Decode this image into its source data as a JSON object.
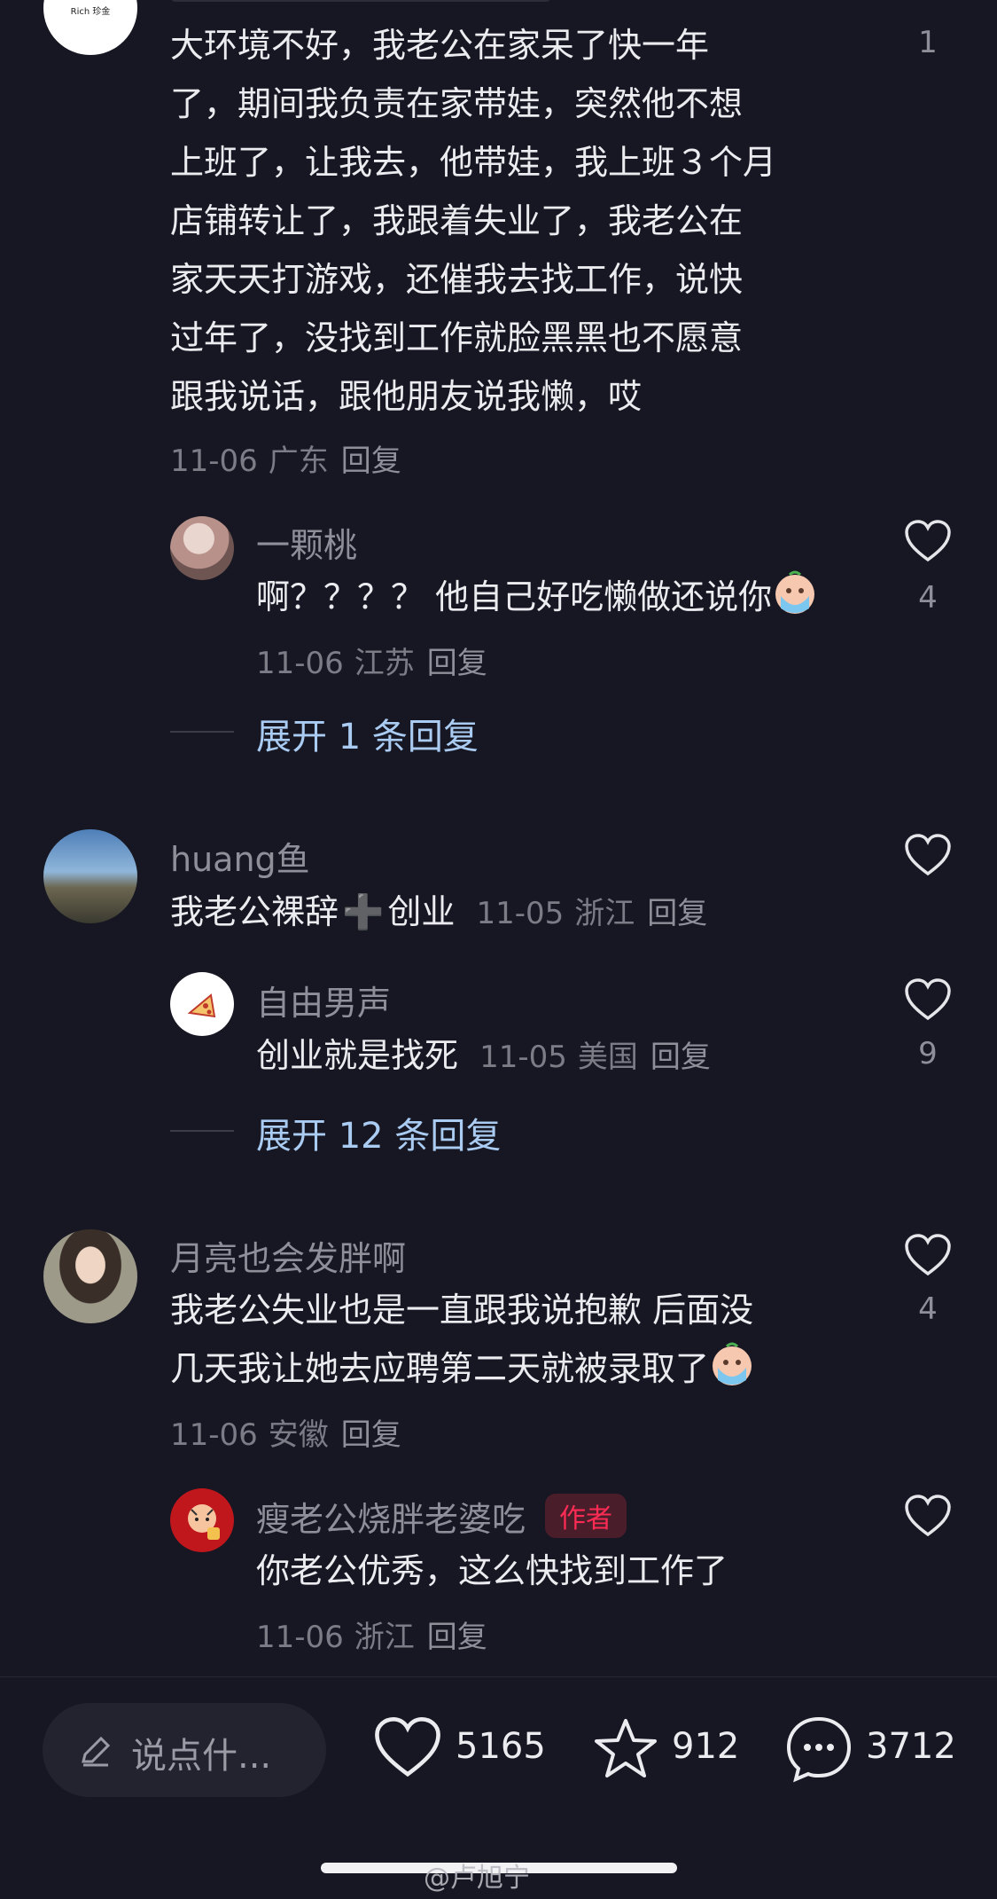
{
  "comments": [
    {
      "avatar_text": "Rich 珍金",
      "lines": [
        "大环境不好，我老公在家呆了快一年",
        "了，期间我负责在家带娃，突然他不想",
        "上班了，让我去，他带娃，我上班３个月",
        "店铺转让了，我跟着失业了，我老公在",
        "家天天打游戏，还催我去找工作，说快",
        "过年了，没找到工作就脸黑黑也不愿意",
        "跟我说话，跟他朋友说我懒，哎"
      ],
      "date": "11-06",
      "location": "广东",
      "reply_label": "回复",
      "likes": "1",
      "reply": {
        "name": "一颗桃",
        "text": "啊？？？？ 他自己好吃懒做还说你",
        "emoji": "crying-face-emoji",
        "date": "11-06",
        "location": "江苏",
        "reply_label": "回复",
        "likes": "4"
      },
      "expand": "展开 1 条回复"
    },
    {
      "name": "huang鱼",
      "text_before": "我老公裸辞",
      "plus_glyph": "➕",
      "text_after": "创业",
      "date": "11-05",
      "location": "浙江",
      "reply_label": "回复",
      "likes": "",
      "reply": {
        "name": "自由男声",
        "text": "创业就是找死",
        "date": "11-05",
        "location": "美国",
        "reply_label": "回复",
        "likes": "9"
      },
      "expand": "展开 12 条回复"
    },
    {
      "name": "月亮也会发胖啊",
      "lines": [
        "我老公失业也是一直跟我说抱歉  后面没",
        "几天我让她去应聘第二天就被录取了"
      ],
      "emoji": "crying-face-emoji",
      "date": "11-06",
      "location": "安徽",
      "reply_label": "回复",
      "likes": "4",
      "reply": {
        "name": "瘦老公烧胖老婆吃",
        "badge": "作者",
        "text": "你老公优秀，这么快找到工作了",
        "date": "11-06",
        "location": "浙江",
        "reply_label": "回复",
        "likes": ""
      }
    }
  ],
  "bottom_bar": {
    "input_placeholder": "说点什...",
    "like_count": "5165",
    "favorite_count": "912",
    "comment_count": "3712"
  },
  "watermark": "@卢旭宁",
  "colors": {
    "background": "#161722",
    "author_badge": "#fe2c55",
    "expand_link": "#aacbf2"
  }
}
